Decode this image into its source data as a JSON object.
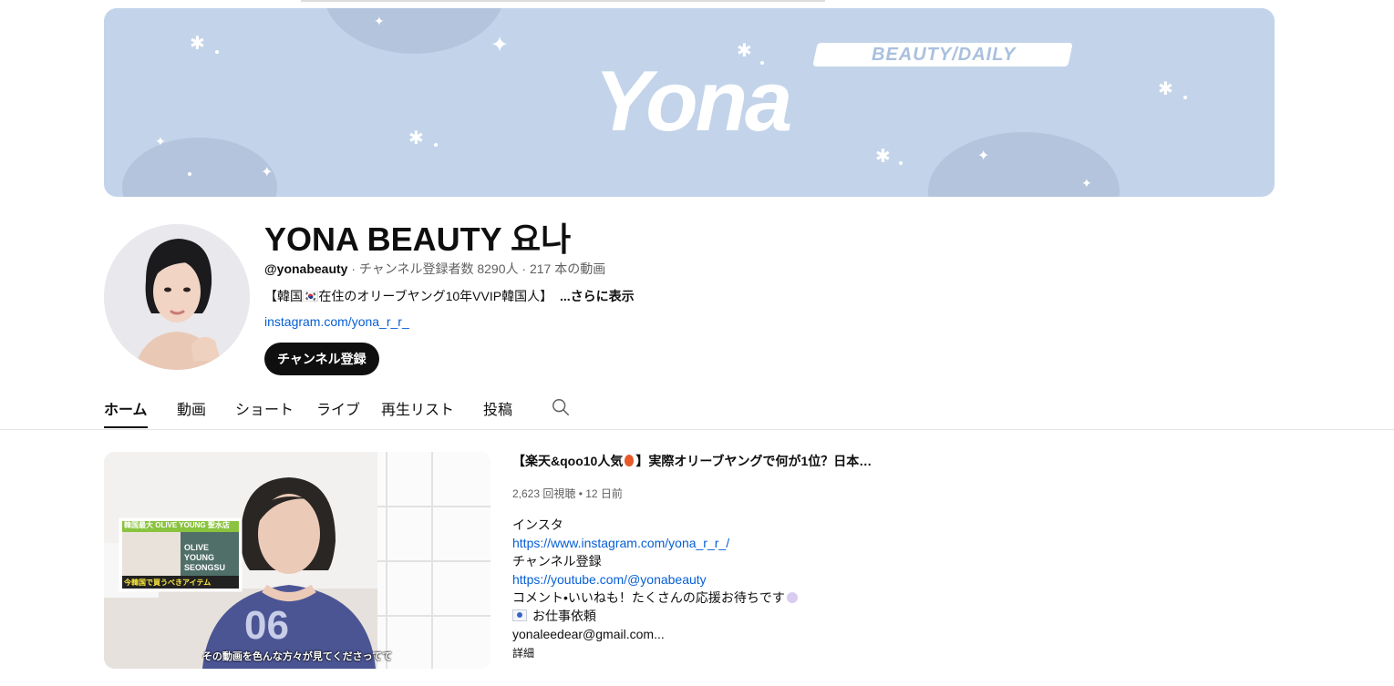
{
  "banner": {
    "logo_text": "Yona",
    "tagline": "BEAUTY/DAILY",
    "bg_color": "#c3d4ea"
  },
  "channel": {
    "name": "YONA BEAUTY 요나",
    "handle": "@yonabeauty",
    "stats": " · チャンネル登録者数 8290人 · 217 本の動画",
    "description": "【韓国🇰🇷在住のオリーブヤング10年VVIP韓国人】",
    "more_label": "...さらに表示",
    "link": "instagram.com/yona_r_r_",
    "subscribe_label": "チャンネル登録"
  },
  "tabs": [
    {
      "label": "ホーム",
      "active": true
    },
    {
      "label": "動画"
    },
    {
      "label": "ショート"
    },
    {
      "label": "ライブ"
    },
    {
      "label": "再生リスト"
    },
    {
      "label": "投稿"
    }
  ],
  "tab_search_icon": "search-icon",
  "featured_video": {
    "title_prefix": "【楽天&qoo10人気",
    "title_suffix": "】実際オリーブヤングで何が1位？日本…",
    "stats": "2,623 回視聴 • 12 日前",
    "thumb_subtitle": "その動画を色んな方々が見てくださってて",
    "thumb_number": "06",
    "thumb_card": {
      "top": "韓国最大 OLIVE YOUNG 聖水店",
      "store": "OLIVE YOUNG SEONGSU",
      "bottom": "今韓国で買うべきアイテム"
    },
    "description_lines": [
      "インスタ",
      "https://www.instagram.com/yona_r_r_/",
      "チャンネル登録",
      "https://youtube.com/@yonabeauty",
      "コメント•いいねも！たくさんの応援お待ちです",
      "お仕事依頼",
      "yonaleedear@gmail.com..."
    ],
    "more_label": "詳細"
  },
  "colors": {
    "link": "#065fd4",
    "text_primary": "#0f0f0f",
    "text_secondary": "#606060"
  }
}
